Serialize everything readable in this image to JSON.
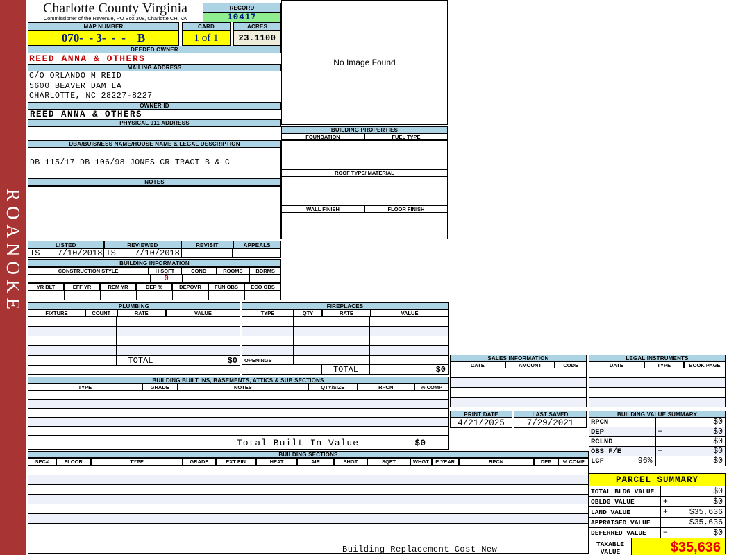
{
  "colors": {
    "header_blue": "#add4e4",
    "sidebar_red": "#a83434",
    "highlight_yellow": "#ffff00",
    "record_green": "#90ee90",
    "acres_cream": "#efeedd",
    "alert_red": "#c00000",
    "taxable_red": "#e80000",
    "map_navy": "#001a7f"
  },
  "sidebar": {
    "vertical_label": "ROANOKE"
  },
  "header": {
    "county_title": "Charlotte County Virginia",
    "county_subtitle": "Commissioner of the Revenue, PO Box 308, Charlotte CH, VA",
    "record_label": "RECORD",
    "record_value": "10417",
    "map_number_label": "MAP NUMBER",
    "map_number_value": "070-  - 3-  -  -    B",
    "card_label": "CARD",
    "card_value": "1 of 1",
    "acres_label": "ACRES",
    "acres_value": "23.1100"
  },
  "owner": {
    "deeded_owner_label": "DEEDED OWNER",
    "deeded_owner": "REED ANNA & OTHERS",
    "mailing_address_label": "MAILING ADDRESS",
    "mailing_lines": [
      "C/O ORLANDO M REID",
      "5600 BEAVER DAM LA",
      "CHARLOTTE, NC 28227-8227"
    ],
    "owner_id_label": "OWNER ID",
    "owner_id": "REED ANNA & OTHERS",
    "physical_address_label": "PHYSICAL 911 ADDRESS",
    "physical_address": ""
  },
  "legal_desc": {
    "dba_label": "DBA/BUISNESS NAME/HOUSE NAME & LEGAL DESCRIPTION",
    "dba_value": "DB 115/17 DB 106/98 JONES CR TRACT B & C",
    "notes_label": "NOTES",
    "notes_value": ""
  },
  "visits": {
    "listed_label": "LISTED",
    "listed_by": "TS",
    "listed_date": "7/10/2018",
    "reviewed_label": "REVIEWED",
    "reviewed_by": "TS",
    "reviewed_date": "7/10/2018",
    "revisit_label": "REVISIT",
    "appeals_label": "APPEALS"
  },
  "building_info": {
    "title": "BUILDING INFORMATION",
    "row1_headers": [
      "CONSTRUCTION STYLE",
      "H SQFT",
      "COND",
      "ROOMS",
      "BDRMS"
    ],
    "h_sqft_value": "0",
    "row2_headers": [
      "YR BLT",
      "EFF YR",
      "REM YR",
      "DEP %",
      "DEPOVR",
      "FUN OBS",
      "ECO OBS"
    ]
  },
  "image_box": {
    "text": "No Image Found"
  },
  "building_properties": {
    "title": "BUILDING PROPERTIES",
    "foundation_label": "FOUNDATION",
    "fuel_type_label": "FUEL TYPE",
    "roof_label": "ROOF TYPE/ MATERIAL",
    "wall_finish_label": "WALL FINISH",
    "floor_finish_label": "FLOOR FINISH"
  },
  "plumbing": {
    "title": "PLUMBING",
    "headers": [
      "FIXTURE",
      "COUNT",
      "RATE",
      "VALUE"
    ],
    "total_label": "TOTAL",
    "total_value": "$0"
  },
  "fireplaces": {
    "title": "FIREPLACES",
    "headers": [
      "TYPE",
      "QTY",
      "RATE",
      "VALUE"
    ],
    "openings_label": "OPENINGS",
    "total_label": "TOTAL",
    "total_value": "$0"
  },
  "built_ins": {
    "title": "BUILDING BUILT INS, BASEMENTS, ATTICS & SUB SECTIONS",
    "headers": [
      "TYPE",
      "GRADE",
      "NOTES",
      "QTY/SIZE",
      "RPCN",
      "% COMP"
    ],
    "total_label": "Total Built In Value",
    "total_value": "$0"
  },
  "building_sections": {
    "title": "BUILDING SECTIONS",
    "headers": [
      "SEC#",
      "FLOOR",
      "TYPE",
      "GRADE",
      "EXT FIN",
      "HEAT",
      "AIR",
      "SHGT",
      "SQFT",
      "WHGT",
      "E YEAR",
      "RPCN",
      "DEP",
      "% COMP"
    ],
    "footer_label": "Building Replacement Cost New"
  },
  "sales_information": {
    "title": "SALES INFORMATION",
    "headers": [
      "DATE",
      "AMOUNT",
      "CODE"
    ]
  },
  "legal_instruments": {
    "title": "LEGAL INSTRUMENTS",
    "headers": [
      "DATE",
      "TYPE",
      "BOOK PAGE"
    ]
  },
  "dates": {
    "print_date_label": "PRINT DATE",
    "print_date": "4/21/2025",
    "last_saved_label": "LAST SAVED",
    "last_saved": "7/29/2021"
  },
  "building_value_summary": {
    "title": "BUILDING VALUE SUMMARY",
    "rows": [
      {
        "label": "RPCN",
        "pct": "",
        "op": "",
        "value": "$0"
      },
      {
        "label": "DEP",
        "pct": "",
        "op": "−",
        "value": "$0"
      },
      {
        "label": "RCLND",
        "pct": "",
        "op": "",
        "value": "$0"
      },
      {
        "label": "OBS F/E",
        "pct": "",
        "op": "−",
        "value": "$0"
      },
      {
        "label": "LCF",
        "pct": "96%",
        "op": "",
        "value": "$0"
      }
    ]
  },
  "parcel_summary": {
    "title": "PARCEL SUMMARY",
    "rows": [
      {
        "label": "TOTAL BLDG VALUE",
        "op": "",
        "value": "$0"
      },
      {
        "label": "OBLDG VALUE",
        "op": "+",
        "value": "$0"
      },
      {
        "label": "LAND VALUE",
        "op": "+",
        "value": "$35,636"
      },
      {
        "label": "APPRAISED VALUE",
        "op": "",
        "value": "$35,636"
      },
      {
        "label": "DEFERRED VALUE",
        "op": "−",
        "value": "$0"
      }
    ],
    "taxable_label_line1": "TAXABLE",
    "taxable_label_line2": "VALUE",
    "taxable_value": "$35,636"
  }
}
